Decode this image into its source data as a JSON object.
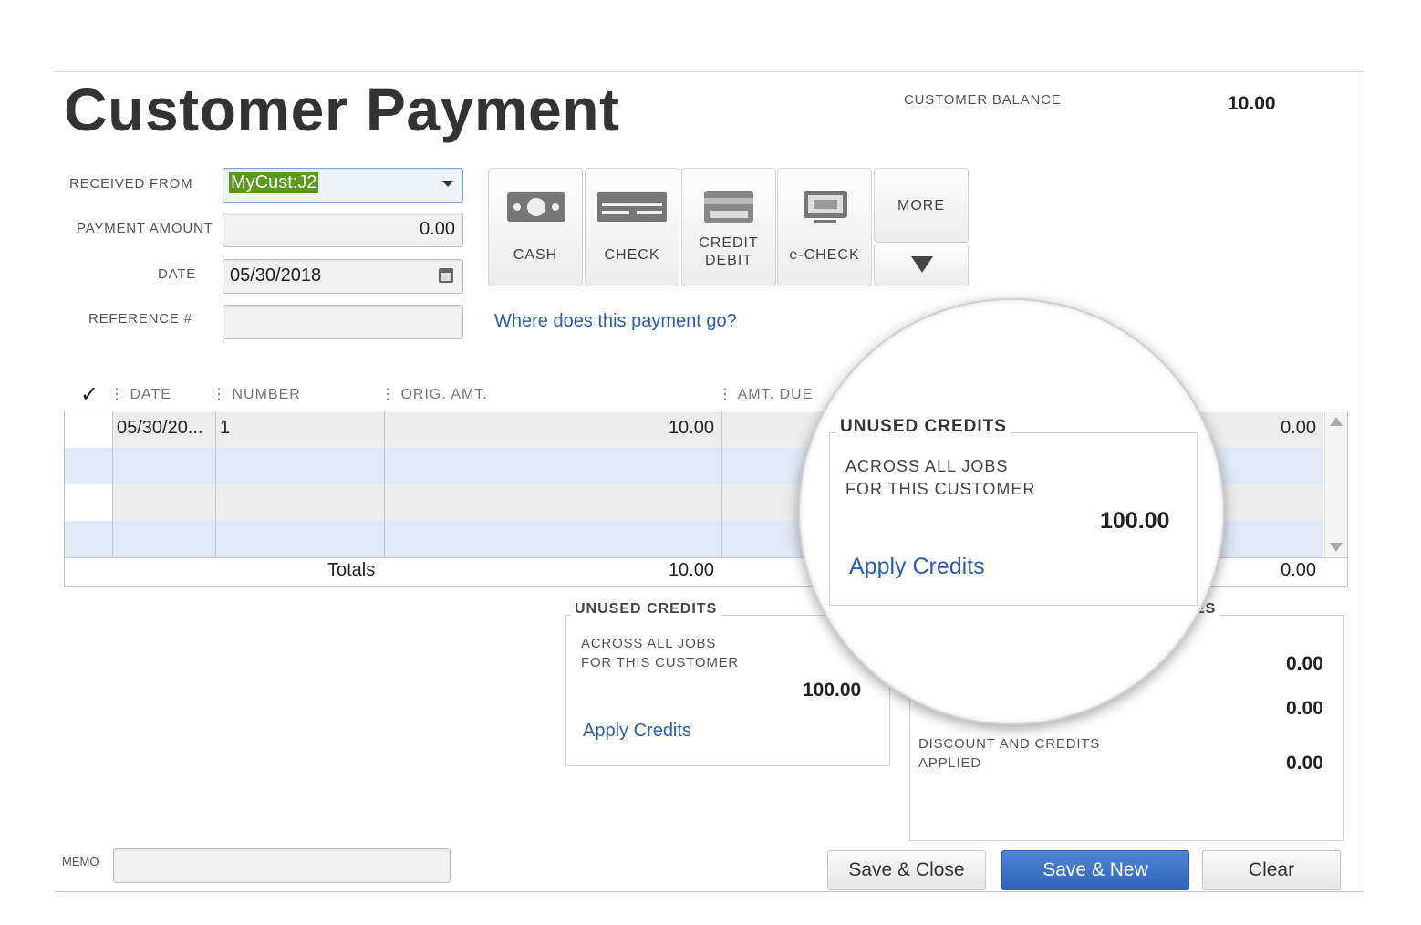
{
  "title": "Customer Payment",
  "customer_balance": {
    "label": "CUSTOMER BALANCE",
    "value": "10.00"
  },
  "form": {
    "received_from": {
      "label": "RECEIVED FROM",
      "value": "MyCust:J2"
    },
    "payment_amount": {
      "label": "PAYMENT AMOUNT",
      "value": "0.00"
    },
    "date": {
      "label": "DATE",
      "value": "05/30/2018"
    },
    "reference": {
      "label": "REFERENCE #",
      "value": ""
    }
  },
  "payment_methods": [
    {
      "label": "CASH",
      "icon": "cash-icon"
    },
    {
      "label": "CHECK",
      "icon": "check-icon"
    },
    {
      "label": "CREDIT\nDEBIT",
      "icon": "credit-card-icon"
    },
    {
      "label": "e-CHECK",
      "icon": "echeck-icon"
    },
    {
      "label": "MORE",
      "icon": "triangle-down-icon"
    }
  ],
  "where_link": "Where does this payment go?",
  "table": {
    "headers": {
      "check": "✓",
      "date": "DATE",
      "number": "NUMBER",
      "orig_amt": "ORIG. AMT.",
      "amt_due": "AMT. DUE"
    },
    "rows": [
      {
        "date": "05/30/20...",
        "number": "1",
        "orig_amt": "10.00",
        "payment": "0.00"
      }
    ],
    "totals": {
      "label": "Totals",
      "orig_amt": "10.00",
      "payment": "0.00"
    }
  },
  "unused_credits": {
    "title": "UNUSED CREDITS",
    "line1": "ACROSS ALL JOBS",
    "line2": "FOR THIS CUSTOMER",
    "amount": "100.00",
    "link": "Apply Credits"
  },
  "summary": {
    "title_fragment": "ES",
    "value1": "0.00",
    "value2": "0.00",
    "discount_label_1": "DISCOUNT AND CREDITS",
    "discount_label_2": "APPLIED",
    "discount_value": "0.00"
  },
  "memo": {
    "label": "MEMO",
    "value": ""
  },
  "buttons": {
    "save_close": "Save & Close",
    "save_new": "Save & New",
    "clear": "Clear"
  }
}
